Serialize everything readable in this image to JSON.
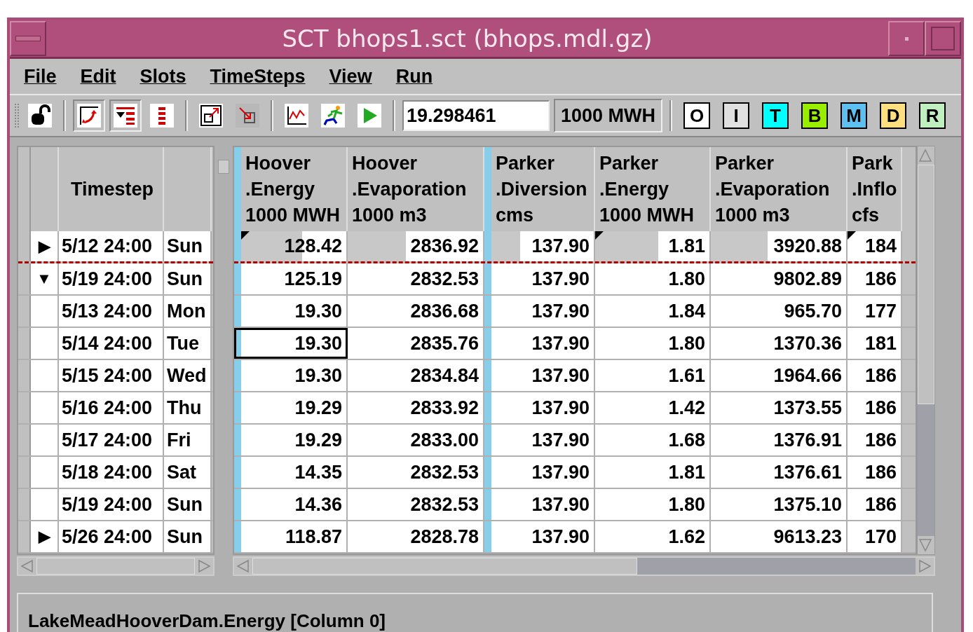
{
  "window": {
    "title": "SCT bhops1.sct (bhops.mdl.gz)"
  },
  "menu": [
    "File",
    "Edit",
    "Slots",
    "TimeSteps",
    "View",
    "Run"
  ],
  "toolbar": {
    "buttons": [
      {
        "kind": "lock",
        "pressed": false
      },
      {
        "kind": "sep"
      },
      {
        "kind": "swap",
        "pressed": true
      },
      {
        "kind": "filter",
        "pressed": true
      },
      {
        "kind": "list",
        "pressed": false
      },
      {
        "kind": "sep"
      },
      {
        "kind": "open",
        "pressed": false
      },
      {
        "kind": "close",
        "pressed": false
      },
      {
        "kind": "sep"
      },
      {
        "kind": "plot",
        "pressed": false
      },
      {
        "kind": "run",
        "pressed": false
      },
      {
        "kind": "play",
        "pressed": false
      }
    ],
    "value": "19.298461",
    "units": "1000 MWH",
    "flags": [
      {
        "label": "O",
        "color": "#ffffff"
      },
      {
        "label": "I",
        "color": "#e0e0e0"
      },
      {
        "label": "T",
        "color": "#00ffff"
      },
      {
        "label": "B",
        "color": "#99ee00"
      },
      {
        "label": "M",
        "color": "#5ec0f0"
      },
      {
        "label": "D",
        "color": "#ffe080"
      },
      {
        "label": "R",
        "color": "#c0f0c0"
      }
    ]
  },
  "left_columns": [
    "Timestep"
  ],
  "columns": [
    {
      "lines": [
        "Hoover",
        ".Energy",
        "1000 MWH"
      ],
      "group_start": true
    },
    {
      "lines": [
        "Hoover",
        ".Evaporation",
        "1000 m3"
      ],
      "group_start": false
    },
    {
      "lines": [
        "Parker",
        ".Diversion",
        "cms"
      ],
      "group_start": true
    },
    {
      "lines": [
        "Parker",
        ".Energy",
        "1000 MWH"
      ],
      "group_start": false
    },
    {
      "lines": [
        "Parker",
        ".Evaporation",
        "1000 m3"
      ],
      "group_start": false
    },
    {
      "lines": [
        "Park",
        ".Inflo",
        "cfs"
      ],
      "group_start": false
    }
  ],
  "rows": [
    {
      "expander": "▶",
      "date": "5/12 24:00",
      "day": "Sun",
      "divider_below": true,
      "cells": [
        {
          "value": "128.42",
          "selected": false,
          "level": 0.58,
          "flagged": true
        },
        {
          "value": "2836.92",
          "selected": false,
          "level": 0.43,
          "flagged": false
        },
        {
          "value": "137.90",
          "selected": false,
          "level": 0.28,
          "flagged": false
        },
        {
          "value": "1.81",
          "selected": false,
          "level": 0.55,
          "flagged": true
        },
        {
          "value": "3920.88",
          "selected": false,
          "level": 0.42,
          "flagged": false
        },
        {
          "value": "184",
          "selected": false,
          "flagged": true
        }
      ]
    },
    {
      "expander": "▼",
      "date": "5/19 24:00",
      "day": "Sun",
      "divider_below": false,
      "cells": [
        {
          "value": "125.19",
          "selected": false
        },
        {
          "value": "2832.53",
          "selected": false
        },
        {
          "value": "137.90",
          "selected": false
        },
        {
          "value": "1.80",
          "selected": false
        },
        {
          "value": "9802.89",
          "selected": false
        },
        {
          "value": "186",
          "selected": false
        }
      ]
    },
    {
      "date": "5/13 24:00",
      "day": "Mon",
      "divider_below": false,
      "cells": [
        {
          "value": "19.30",
          "selected": false
        },
        {
          "value": "2836.68",
          "selected": false
        },
        {
          "value": "137.90",
          "selected": false
        },
        {
          "value": "1.84",
          "selected": false
        },
        {
          "value": "965.70",
          "selected": false
        },
        {
          "value": "177",
          "selected": false
        }
      ]
    },
    {
      "date": "5/14 24:00",
      "day": "Tue",
      "divider_below": false,
      "cells": [
        {
          "value": "19.30",
          "selected": true
        },
        {
          "value": "2835.76",
          "selected": false
        },
        {
          "value": "137.90",
          "selected": false
        },
        {
          "value": "1.80",
          "selected": false
        },
        {
          "value": "1370.36",
          "selected": false
        },
        {
          "value": "181",
          "selected": false
        }
      ]
    },
    {
      "date": "5/15 24:00",
      "day": "Wed",
      "divider_below": false,
      "cells": [
        {
          "value": "19.30",
          "selected": false
        },
        {
          "value": "2834.84",
          "selected": false
        },
        {
          "value": "137.90",
          "selected": false
        },
        {
          "value": "1.61",
          "selected": false
        },
        {
          "value": "1964.66",
          "selected": false
        },
        {
          "value": "186",
          "selected": false
        }
      ]
    },
    {
      "date": "5/16 24:00",
      "day": "Thu",
      "divider_below": false,
      "cells": [
        {
          "value": "19.29",
          "selected": false
        },
        {
          "value": "2833.92",
          "selected": false
        },
        {
          "value": "137.90",
          "selected": false
        },
        {
          "value": "1.42",
          "selected": false
        },
        {
          "value": "1373.55",
          "selected": false
        },
        {
          "value": "186",
          "selected": false
        }
      ]
    },
    {
      "date": "5/17 24:00",
      "day": "Fri",
      "divider_below": false,
      "cells": [
        {
          "value": "19.29",
          "selected": false
        },
        {
          "value": "2833.00",
          "selected": false
        },
        {
          "value": "137.90",
          "selected": false
        },
        {
          "value": "1.68",
          "selected": false
        },
        {
          "value": "1376.91",
          "selected": false
        },
        {
          "value": "186",
          "selected": false
        }
      ]
    },
    {
      "date": "5/18 24:00",
      "day": "Sat",
      "divider_below": false,
      "cells": [
        {
          "value": "14.35",
          "selected": false
        },
        {
          "value": "2832.53",
          "selected": false
        },
        {
          "value": "137.90",
          "selected": false
        },
        {
          "value": "1.81",
          "selected": false
        },
        {
          "value": "1376.61",
          "selected": false
        },
        {
          "value": "186",
          "selected": false
        }
      ]
    },
    {
      "date": "5/19 24:00",
      "day": "Sun",
      "divider_below": false,
      "cells": [
        {
          "value": "14.36",
          "selected": false
        },
        {
          "value": "2832.53",
          "selected": false
        },
        {
          "value": "137.90",
          "selected": false
        },
        {
          "value": "1.80",
          "selected": false
        },
        {
          "value": "1375.10",
          "selected": false
        },
        {
          "value": "186",
          "selected": false
        }
      ]
    },
    {
      "expander": "▶",
      "date": "5/26 24:00",
      "day": "Sun",
      "divider_below": false,
      "cells": [
        {
          "value": "118.87",
          "selected": false
        },
        {
          "value": "2828.78",
          "selected": false
        },
        {
          "value": "137.90",
          "selected": false
        },
        {
          "value": "1.62",
          "selected": false
        },
        {
          "value": "9613.23",
          "selected": false
        },
        {
          "value": "170",
          "selected": false
        }
      ]
    }
  ],
  "status_bar": "LakeMeadHooverDam.Energy [Column 0]"
}
